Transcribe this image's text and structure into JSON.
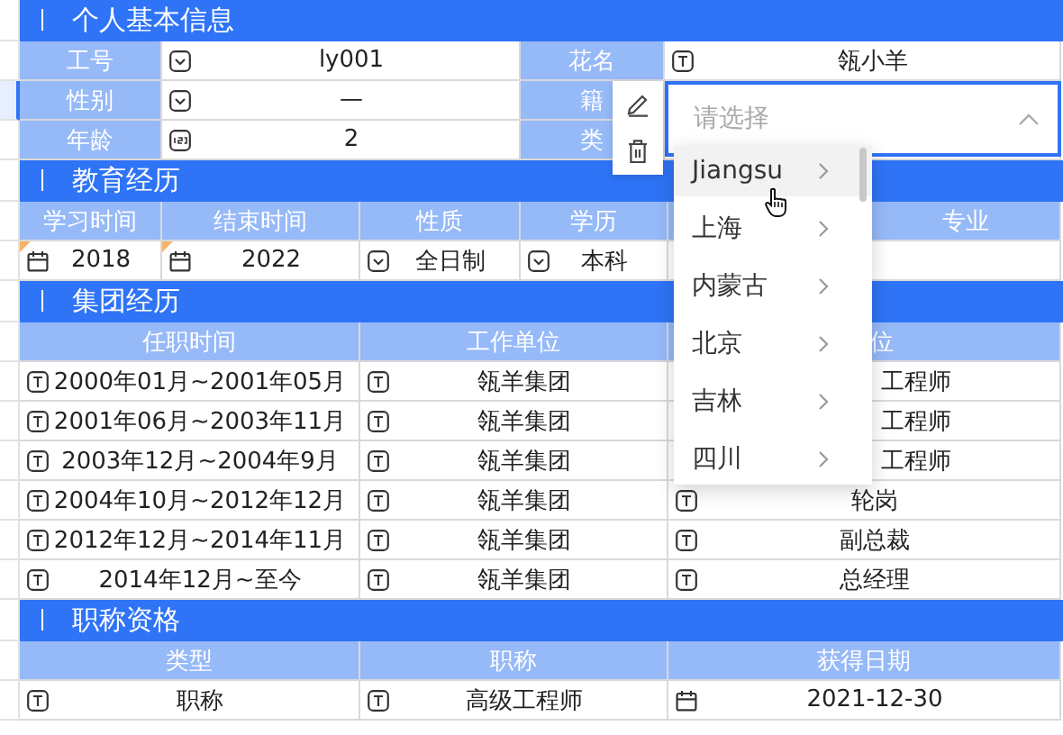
{
  "sections": [
    {
      "kind": "form",
      "title": "个人基本信息",
      "rows": [
        {
          "selected": false,
          "fields": [
            {
              "label": "工号",
              "kind": "select",
              "value": "ly001"
            },
            {
              "label": "花名",
              "kind": "text",
              "value": "瓴小羊"
            }
          ]
        },
        {
          "selected": true,
          "fields": [
            {
              "label": "性别",
              "kind": "select",
              "value": "—"
            },
            {
              "label": "籍",
              "kind": "picker",
              "placeholder": "请选择",
              "expanded": true,
              "options": [
                {
                  "label": "Jiangsu",
                  "hovered": true
                },
                {
                  "label": "上海",
                  "hovered": false
                },
                {
                  "label": "内蒙古",
                  "hovered": false
                },
                {
                  "label": "北京",
                  "hovered": false
                },
                {
                  "label": "吉林",
                  "hovered": false
                },
                {
                  "label": "四川",
                  "hovered": false
                }
              ]
            }
          ]
        },
        {
          "selected": false,
          "fields": [
            {
              "label": "年龄",
              "kind": "number",
              "value": "2"
            },
            {
              "label": "类"
            }
          ]
        }
      ]
    },
    {
      "kind": "table",
      "title": "教育经历",
      "columns": [
        "学习时间",
        "结束时间",
        "性质",
        "学历",
        null,
        "专业"
      ],
      "rows": [
        [
          {
            "kind": "date",
            "value": "2018",
            "flagged": true
          },
          {
            "kind": "date",
            "value": "2022",
            "flagged": true
          },
          {
            "kind": "select",
            "value": "全日制"
          },
          {
            "kind": "select",
            "value": "本科"
          },
          {},
          {}
        ]
      ]
    },
    {
      "kind": "table",
      "title": "集团经历",
      "columns": [
        "任职时间",
        "工作单位",
        "位"
      ],
      "rows": [
        [
          {
            "kind": "text",
            "value": "2000年01月~2001年05月"
          },
          {
            "kind": "text",
            "value": "瓴羊集团"
          },
          {
            "value": "工程师"
          }
        ],
        [
          {
            "kind": "text",
            "value": "2001年06月~2003年11月"
          },
          {
            "kind": "text",
            "value": "瓴羊集团"
          },
          {
            "value": "工程师"
          }
        ],
        [
          {
            "kind": "text",
            "value": "2003年12月~2004年9月"
          },
          {
            "kind": "text",
            "value": "瓴羊集团"
          },
          {
            "value": "工程师"
          }
        ],
        [
          {
            "kind": "text",
            "value": "2004年10月~2012年12月"
          },
          {
            "kind": "text",
            "value": "瓴羊集团"
          },
          {
            "kind": "text",
            "value": "轮岗"
          }
        ],
        [
          {
            "kind": "text",
            "value": "2012年12月~2014年11月"
          },
          {
            "kind": "text",
            "value": "瓴羊集团"
          },
          {
            "kind": "text",
            "value": "副总裁"
          }
        ],
        [
          {
            "kind": "text",
            "value": "2014年12月~至今"
          },
          {
            "kind": "text",
            "value": "瓴羊集团"
          },
          {
            "kind": "text",
            "value": "总经理"
          }
        ]
      ]
    },
    {
      "kind": "table",
      "title": "职称资格",
      "columns": [
        "类型",
        "职称",
        "获得日期"
      ],
      "rows": [
        [
          {
            "kind": "text",
            "value": "职称"
          },
          {
            "kind": "text",
            "value": "高级工程师"
          },
          {
            "kind": "date",
            "value": "2021-12-30"
          }
        ]
      ]
    }
  ]
}
